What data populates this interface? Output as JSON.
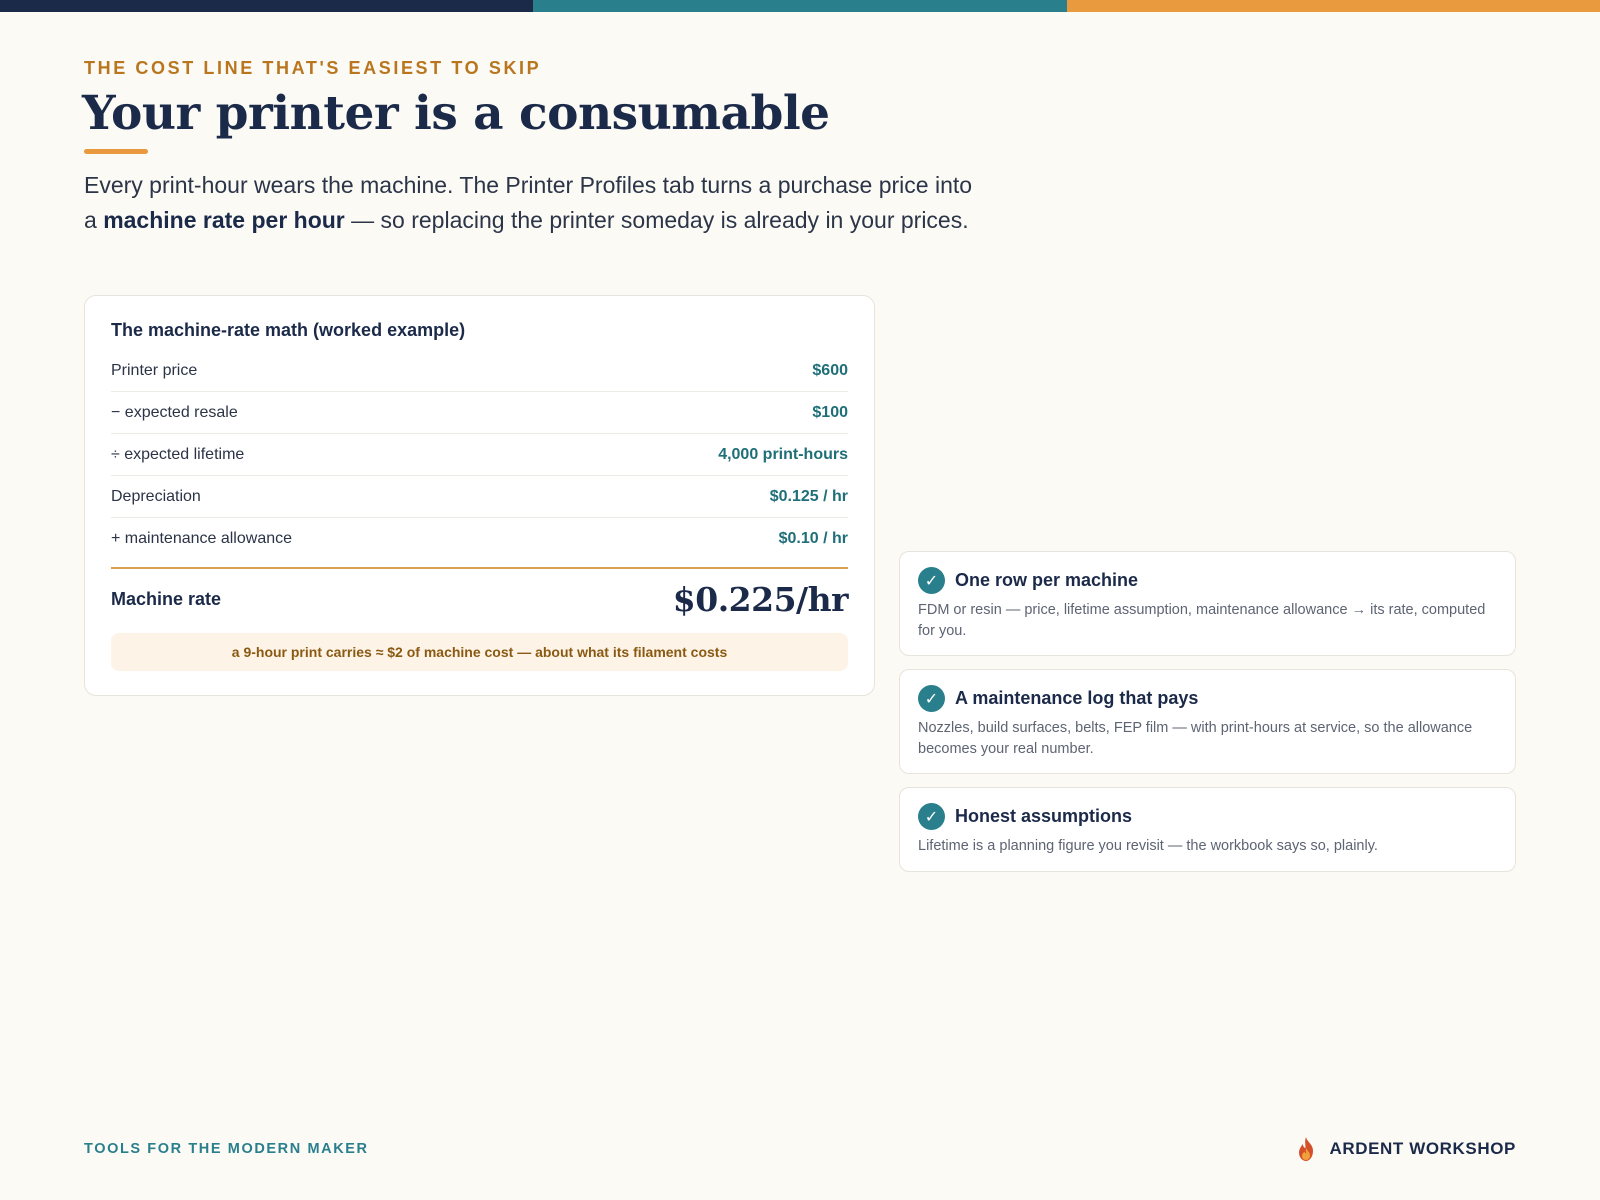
{
  "colors": {
    "navy": "#1c2a4a",
    "teal": "#2a7f8c",
    "orange": "#e99a3f",
    "gold": "#b9761f",
    "note_bg": "#fdf3e6",
    "note_text": "#8a5a12"
  },
  "header": {
    "eyebrow": "THE COST LINE THAT'S EASIEST TO SKIP",
    "title": "Your printer is a consumable",
    "lead_start": "Every print-hour wears the machine. The Printer Profiles tab turns a purchase price into a ",
    "lead_bold": "machine rate per hour",
    "lead_end": " — so replacing the printer someday is already in your prices."
  },
  "calc": {
    "title": "The machine-rate math (worked example)",
    "rows": [
      {
        "label": "Printer price",
        "value": "$600"
      },
      {
        "label": "− expected resale",
        "value": "$100"
      },
      {
        "label": "÷ expected lifetime",
        "value": "4,000 print-hours"
      },
      {
        "label": "Depreciation",
        "value": "$0.125 / hr"
      },
      {
        "label": "+ maintenance allowance",
        "value": "$0.10 / hr"
      }
    ],
    "total_label": "Machine rate",
    "total_value": "$0.225/hr",
    "note": "a 9-hour print carries ≈ $2 of machine cost — about what its filament costs"
  },
  "features": [
    {
      "icon": "check-icon",
      "title": "One row per machine",
      "desc": "FDM or resin — price, lifetime assumption, maintenance allowance → its rate, computed for you."
    },
    {
      "icon": "check-icon",
      "title": "A maintenance log that pays",
      "desc": "Nozzles, build surfaces, belts, FEP film — with print-hours at service, so the allowance becomes your real number."
    },
    {
      "icon": "check-icon",
      "title": "Honest assumptions",
      "desc": "Lifetime is a planning figure you revisit — the workbook says so, plainly."
    }
  ],
  "footer": {
    "tagline": "TOOLS FOR THE MODERN MAKER",
    "brand_icon": "flame-logo-icon",
    "brand": "ARDENT WORKSHOP"
  }
}
